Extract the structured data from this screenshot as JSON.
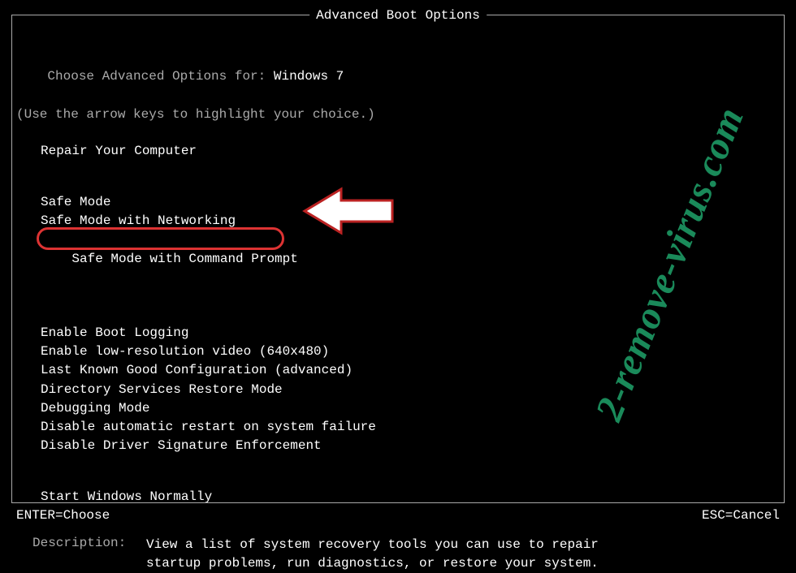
{
  "title": "Advanced Boot Options",
  "header_line1_prefix": "Choose Advanced Options for: ",
  "header_line1_os": "Windows 7",
  "header_line2": "(Use the arrow keys to highlight your choice.)",
  "repair_option": "Repair Your Computer",
  "safe_modes": {
    "item0": "Safe Mode",
    "item1": "Safe Mode with Networking",
    "item2": "Safe Mode with Command Prompt"
  },
  "advanced": {
    "item0": "Enable Boot Logging",
    "item1": "Enable low-resolution video (640x480)",
    "item2": "Last Known Good Configuration (advanced)",
    "item3": "Directory Services Restore Mode",
    "item4": "Debugging Mode",
    "item5": "Disable automatic restart on system failure",
    "item6": "Disable Driver Signature Enforcement"
  },
  "start_normal": "Start Windows Normally",
  "description_label": "Description:",
  "description_text": "View a list of system recovery tools you can use to repair startup problems, run diagnostics, or restore your system.",
  "footer_left": "ENTER=Choose",
  "footer_right": "ESC=Cancel",
  "watermark": "2-remove-virus.com"
}
